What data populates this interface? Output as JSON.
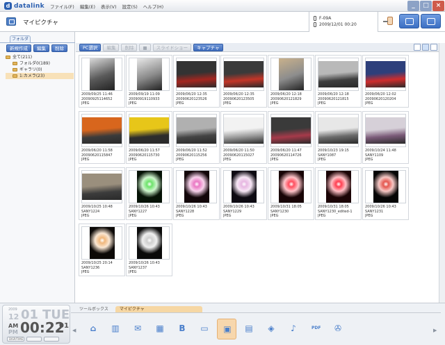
{
  "app": {
    "brand": "datalink"
  },
  "menu": {
    "items": [
      "ファイル(F)",
      "編集(E)",
      "表示(V)",
      "設定(S)",
      "ヘルプ(H)"
    ]
  },
  "window": {
    "minimize": "_",
    "maximize": "□",
    "close": "×"
  },
  "header": {
    "title": "マイピクチャ"
  },
  "device": {
    "model": "F-09A",
    "timestamp": "2009/12/01 00:20"
  },
  "sidebar": {
    "tab": "フォルダ",
    "buttons": [
      "新規作成",
      "編集",
      "削除"
    ],
    "tree": [
      {
        "label": "全て(211)",
        "level": 0,
        "selected": false
      },
      {
        "label": "フォルダ0(189)",
        "level": 1,
        "selected": false
      },
      {
        "label": "ギャラリ(0)",
        "level": 1,
        "selected": false
      },
      {
        "label": "1:カメラ(23)",
        "level": 1,
        "selected": true
      }
    ]
  },
  "toolbar": {
    "pc_select": "PC選択",
    "edit": "編集",
    "delete": "削除",
    "lock": "",
    "play": "スライドショー",
    "capture": "キャプチャ"
  },
  "photos": [
    {
      "date": "2009/09/25 11:46",
      "name": "20090925114652",
      "type": "JPEG",
      "img": "portrait-dark",
      "color": "#5a5a5a",
      "accent": "#d9d9d9"
    },
    {
      "date": "2009/09/19 11:09",
      "name": "20090919110933",
      "type": "JPEG",
      "img": "portrait-dark",
      "color": "#8a8a8a",
      "accent": "#e8e8e8"
    },
    {
      "date": "2009/06/20 12:35",
      "name": "20090620123526",
      "type": "JPEG",
      "img": "landscape",
      "color": "#333333",
      "accent": "#a5261f"
    },
    {
      "date": "2009/06/20 12:35",
      "name": "20090620123505",
      "type": "JPEG",
      "img": "landscape",
      "color": "#3a3a3a",
      "accent": "#c43527"
    },
    {
      "date": "2009/06/20 12:18",
      "name": "20090620121829",
      "type": "JPEG",
      "img": "portrait",
      "color": "#8d8d8d",
      "accent": "#c9b18b"
    },
    {
      "date": "2009/06/20 12:18",
      "name": "20090620121815",
      "type": "JPEG",
      "img": "landscape",
      "color": "#b9b9b9",
      "accent": "#3f3f3f"
    },
    {
      "date": "2009/06/20 12:02",
      "name": "20090620120204",
      "type": "JPEG",
      "img": "landscape",
      "color": "#2d3f7b",
      "accent": "#d02c2c"
    },
    {
      "date": "2009/06/20 11:58",
      "name": "20090620115847",
      "type": "JPEG",
      "img": "landscape",
      "color": "#d8661d",
      "accent": "#3b3b3b"
    },
    {
      "date": "2009/06/20 11:57",
      "name": "20090620115730",
      "type": "JPEG",
      "img": "landscape",
      "color": "#e7c619",
      "accent": "#2d2d2d"
    },
    {
      "date": "2009/06/20 11:52",
      "name": "20090620115256",
      "type": "JPEG",
      "img": "landscape",
      "color": "#b0b0b0",
      "accent": "#444444"
    },
    {
      "date": "2009/06/20 11:50",
      "name": "20090620115027",
      "type": "JPEG",
      "img": "landscape",
      "color": "#f2f2f2",
      "accent": "#9b9b9b"
    },
    {
      "date": "2009/06/20 11:47",
      "name": "20090620114726",
      "type": "JPEG",
      "img": "landscape",
      "color": "#3a3a3a",
      "accent": "#a63a4a"
    },
    {
      "date": "2009/10/23 19:15",
      "name": "SANY1087",
      "type": "JPEG",
      "img": "landscape",
      "color": "#e7e7e7",
      "accent": "#6b6b6b"
    },
    {
      "date": "2009/10/24 11:48",
      "name": "SANY1109",
      "type": "JPEG",
      "img": "landscape",
      "color": "#d6d0d8",
      "accent": "#7a5a78"
    },
    {
      "date": "2009/10/25 10:48",
      "name": "SANY1224",
      "type": "JPEG",
      "img": "landscape",
      "color": "#9a8f7d",
      "accent": "#3c3c3c"
    },
    {
      "date": "2009/10/26 10:43",
      "name": "SANY1227",
      "type": "JPEG",
      "img": "firework",
      "color": "#061206",
      "accent": "#6ee36b"
    },
    {
      "date": "2009/10/26 10:43",
      "name": "SANY1228",
      "type": "JPEG",
      "img": "firework",
      "color": "#120609",
      "accent": "#ea78c4"
    },
    {
      "date": "2009/10/26 10:43",
      "name": "SANY1229",
      "type": "JPEG",
      "img": "firework",
      "color": "#0d0a12",
      "accent": "#e7b7e2"
    },
    {
      "date": "2009/10/31 18:05",
      "name": "SANY1230",
      "type": "JPEG",
      "img": "firework",
      "color": "#180406",
      "accent": "#ff4d5d"
    },
    {
      "date": "2009/10/31 18:05",
      "name": "SANY1230_edited-1",
      "type": "JPEG",
      "img": "firework",
      "color": "#1b0406",
      "accent": "#ff3e50"
    },
    {
      "date": "2009/10/26 10:43",
      "name": "SANY1231",
      "type": "JPEG",
      "img": "firework",
      "color": "#050505",
      "accent": "#e5574f"
    },
    {
      "date": "2009/10/25 20:14",
      "name": "SANY1236",
      "type": "JPEG",
      "img": "firework",
      "color": "#0c0907",
      "accent": "#f0b77c"
    },
    {
      "date": "2009/10/26 10:43",
      "name": "SANY1237",
      "type": "JPEG",
      "img": "firework",
      "color": "#0a0a0a",
      "accent": "#cfcfcf"
    }
  ],
  "clock": {
    "year": "2009",
    "month": "12",
    "day": "01",
    "weekday": "TUE",
    "am": "AM",
    "pm": "PM",
    "time": "00:22",
    "seconds": "01",
    "buttons": [
      "DISP/TIME",
      "",
      ""
    ]
  },
  "dock": {
    "tabs": [
      "ツールボックス",
      "マイピクチャ"
    ],
    "active_tab": 1,
    "left_arrow": "◀",
    "right_arrow": "▶",
    "icons": [
      {
        "name": "home-icon",
        "glyph": "⌂",
        "color": "#4a7fcb"
      },
      {
        "name": "book-icon",
        "glyph": "▥",
        "color": "#4a7fcb"
      },
      {
        "name": "mail-icon",
        "glyph": "✉",
        "color": "#4a7fcb"
      },
      {
        "name": "calendar-icon",
        "glyph": "▦",
        "color": "#4a7fcb"
      },
      {
        "name": "bookmark-icon",
        "glyph": "B",
        "color": "#4a7fcb"
      },
      {
        "name": "display-icon",
        "glyph": "▭",
        "color": "#4a7fcb"
      },
      {
        "name": "picture-icon",
        "glyph": "▣",
        "color": "#4a7fcb",
        "selected": true
      },
      {
        "name": "film-icon",
        "glyph": "▤",
        "color": "#4a7fcb"
      },
      {
        "name": "stack-icon",
        "glyph": "◈",
        "color": "#4a7fcb"
      },
      {
        "name": "music-icon",
        "glyph": "♪",
        "color": "#4a7fcb"
      },
      {
        "name": "pdf-icon",
        "glyph": "PDF",
        "color": "#4a7fcb"
      },
      {
        "name": "tools-icon",
        "glyph": "✇",
        "color": "#4a7fcb"
      }
    ]
  }
}
